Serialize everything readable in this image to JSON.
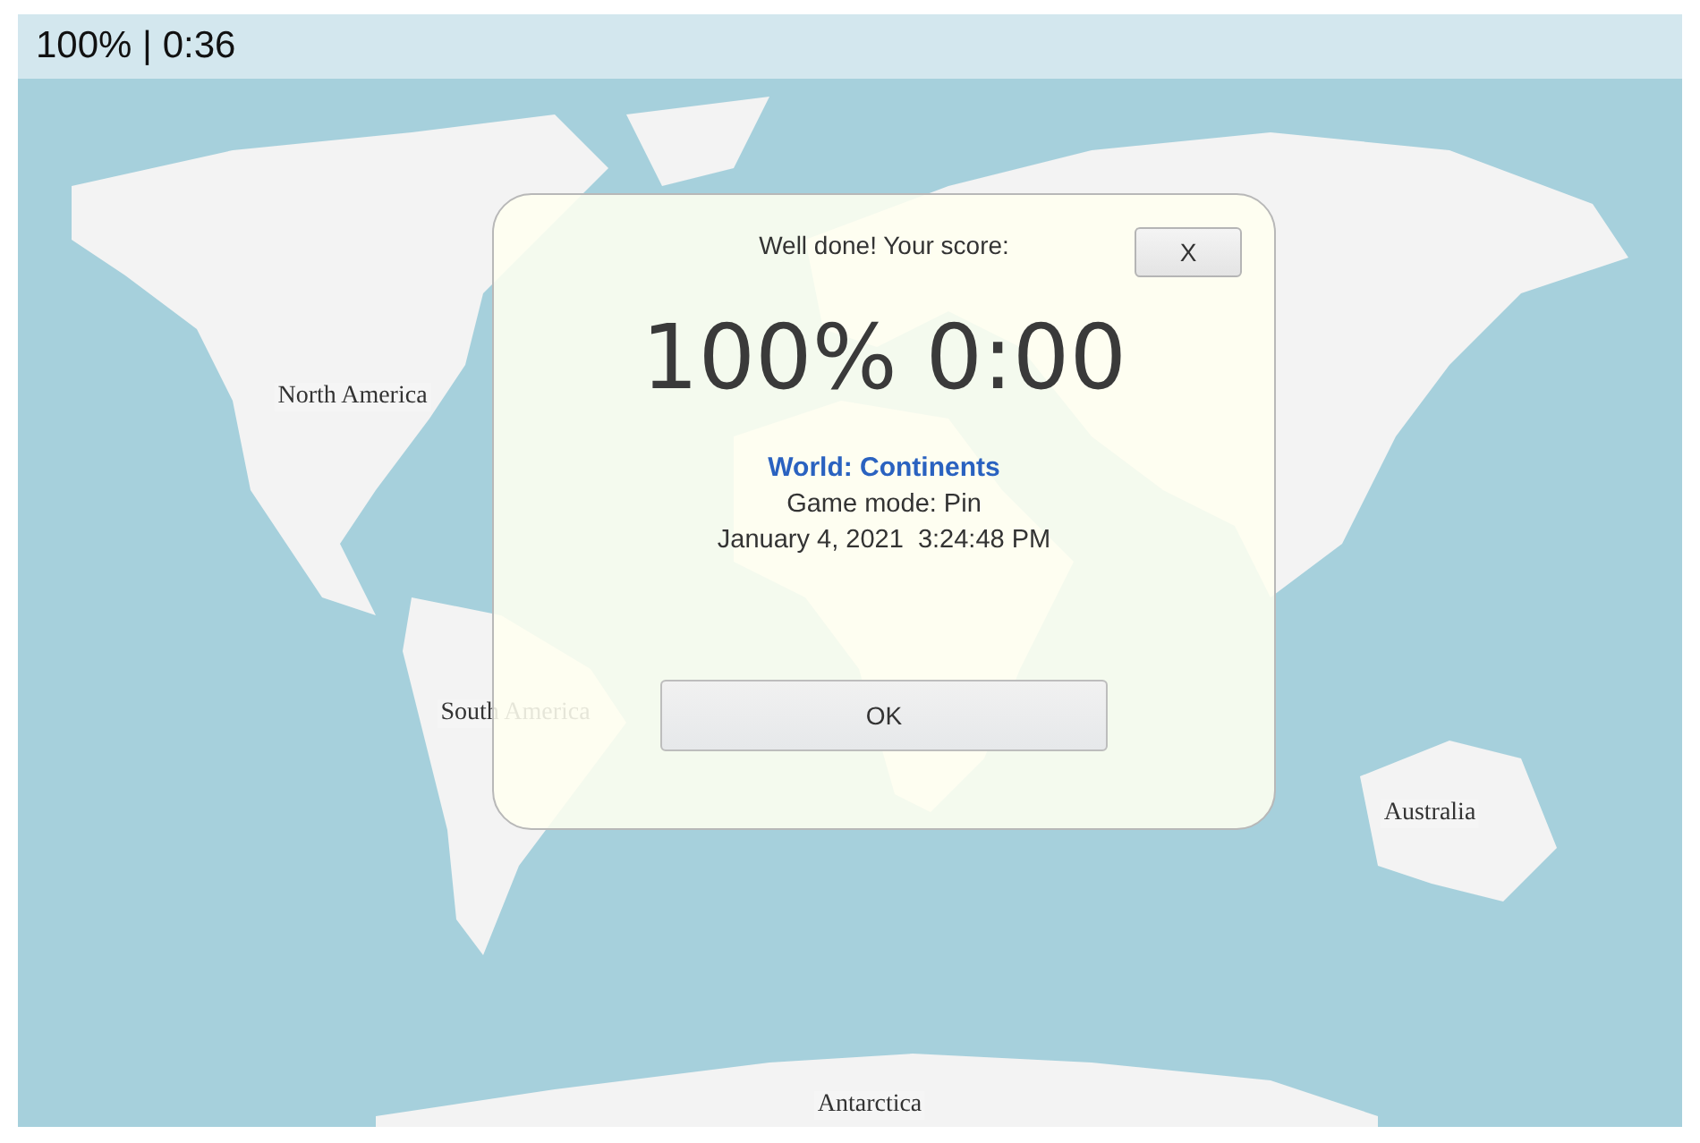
{
  "status_bar": {
    "text": "100% | 0:36"
  },
  "map": {
    "labels": [
      {
        "text": "North America"
      },
      {
        "text": "South America"
      },
      {
        "text": "Australia"
      },
      {
        "text": "Antarctica"
      }
    ]
  },
  "dialog": {
    "heading": "Well done! Your score:",
    "close_button": "X",
    "score": "100% 0:00",
    "quiz_title": "World: Continents",
    "game_mode": "Game mode: Pin",
    "date": "January 4, 2021  3:24:48 PM",
    "ok_button": "OK"
  }
}
